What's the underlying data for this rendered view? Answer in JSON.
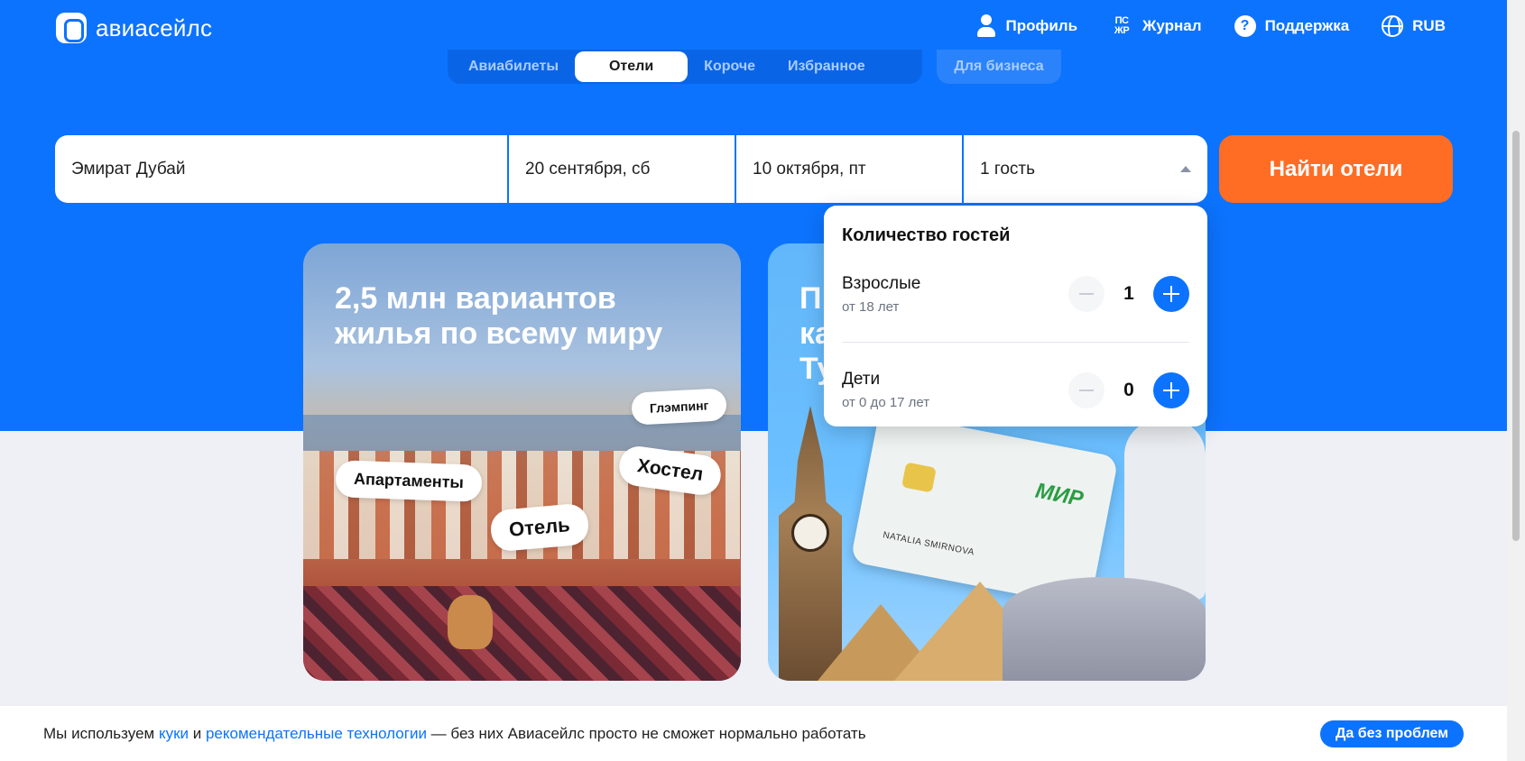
{
  "header": {
    "logo_text": "авиасейлс",
    "nav": [
      {
        "label": "Профиль",
        "icon": "user-icon"
      },
      {
        "label": "Журнал",
        "icon": "journal-icon",
        "icon_text": "ПС ЖР"
      },
      {
        "label": "Поддержка",
        "icon": "help-icon",
        "icon_text": "?"
      },
      {
        "label": "RUB",
        "icon": "globe-icon"
      }
    ]
  },
  "tabs": {
    "items": [
      "Авиабилеты",
      "Отели",
      "Короче",
      "Избранное"
    ],
    "active": "Отели",
    "business": "Для бизнеса"
  },
  "search": {
    "destination": "Эмират Дубай",
    "checkin": "20 сентября, сб",
    "checkout": "10 октября, пт",
    "guests": "1 гость",
    "submit": "Найти отели"
  },
  "guests_popup": {
    "title": "Количество гостей",
    "adults": {
      "label": "Взрослые",
      "sub": "от 18 лет",
      "count": "1"
    },
    "children": {
      "label": "Дети",
      "sub": "от 0 до 17 лет",
      "count": "0"
    }
  },
  "promo": {
    "card1": {
      "title_line1": "2,5 млн вариантов",
      "title_line2": "жилья по всему миру",
      "bubbles": [
        "Глэмпинг",
        "Хостел",
        "Апартаменты",
        "Отель"
      ]
    },
    "card2": {
      "title_line1": "П",
      "title_line2": "ка",
      "title_line3": "Ту",
      "card_brand": "МИР",
      "card_holder": "NATALIA SMIRNOVA"
    }
  },
  "cookie": {
    "text_before": "Мы используем ",
    "link1": "куки",
    "text_mid": " и ",
    "link2": "рекомендательные технологии",
    "text_after": " — без них Авиасейлс просто не сможет нормально работать",
    "button": "Да без проблем"
  },
  "colors": {
    "brand_blue": "#0c73fe",
    "cta_orange": "#ff6d24"
  }
}
